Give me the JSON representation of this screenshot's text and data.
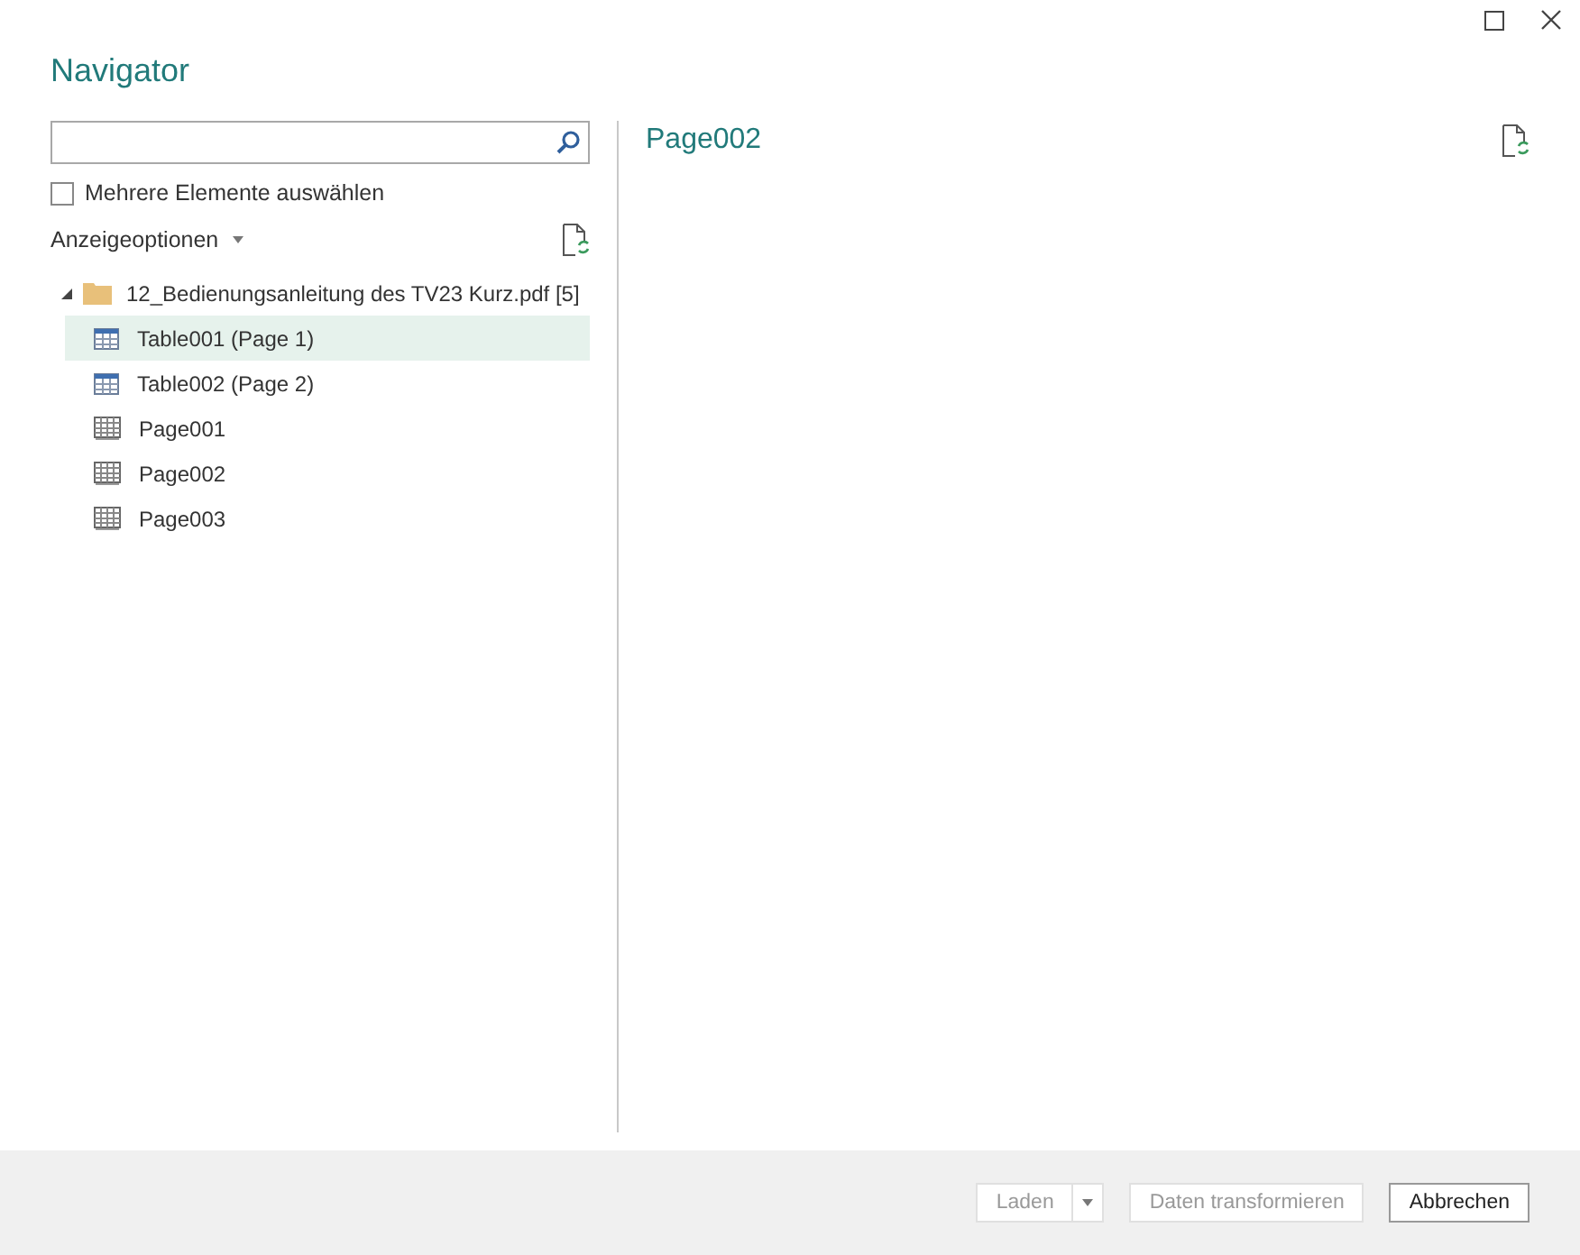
{
  "window": {
    "title": "Navigator"
  },
  "multi_select": {
    "label": "Mehrere Elemente auswählen",
    "checked": false
  },
  "display_options": {
    "label": "Anzeigeoptionen"
  },
  "tree": {
    "label": "12_Bedienungsanleitung des TV23 Kurz.pdf [5]",
    "expanded": true,
    "children": [
      {
        "label": "Table001 (Page 1)",
        "kind": "table",
        "selected": true
      },
      {
        "label": "Table002 (Page 2)",
        "kind": "table",
        "selected": false
      },
      {
        "label": "Page001",
        "kind": "page",
        "selected": false
      },
      {
        "label": "Page002",
        "kind": "page",
        "selected": false
      },
      {
        "label": "Page003",
        "kind": "page",
        "selected": false
      }
    ]
  },
  "preview": {
    "title": "Page002"
  },
  "buttons": [
    {
      "label": "Laden",
      "kind": "split",
      "disabled": true
    },
    {
      "label": "Daten transformieren",
      "kind": "plain",
      "disabled": true
    },
    {
      "label": "Abbrechen",
      "kind": "plain",
      "disabled": false
    }
  ]
}
